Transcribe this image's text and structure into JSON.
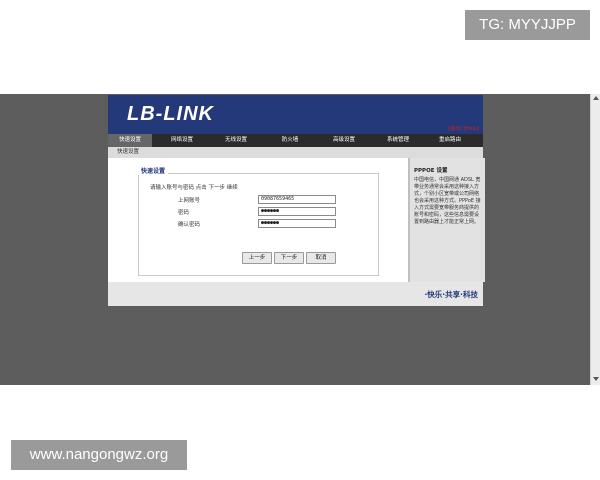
{
  "watermarks": {
    "top": "TG: MYYJJPP",
    "bottom": "www.nangongwz.org"
  },
  "brand": {
    "logo": "LB-LINK",
    "header_link": "[退出] [Help]"
  },
  "nav": {
    "items": [
      {
        "label": "快速设置",
        "active": true
      },
      {
        "label": "网络设置"
      },
      {
        "label": "无线设置"
      },
      {
        "label": "防火墙"
      },
      {
        "label": "高级设置"
      },
      {
        "label": "系统管理"
      },
      {
        "label": "重启路由"
      }
    ],
    "sub": "快速设置"
  },
  "wizard": {
    "legend": "快速设置",
    "instruction": "请输入账号与密码 点击 下一步 继续",
    "fields": [
      {
        "label": "上网账号",
        "value": "09087659465"
      },
      {
        "label": "密码",
        "value": "●●●●●●"
      },
      {
        "label": "确认密码",
        "value": "●●●●●●"
      }
    ],
    "buttons": {
      "prev": "上一步",
      "next": "下一步",
      "cancel": "取消"
    }
  },
  "help": {
    "title": "PPPOE 设置",
    "text": "中国电信，中国网通 ADSL 宽带业务通常会采用这种接入方式，个别小区宽带或公司网络也会采用这种方式。PPPoE 接入方式需要宽带服务商提供的账号和密码，这些信息需要设置到路由器上才能正常上网。"
  },
  "footer": {
    "slogan": "·快乐·共享·科技"
  }
}
